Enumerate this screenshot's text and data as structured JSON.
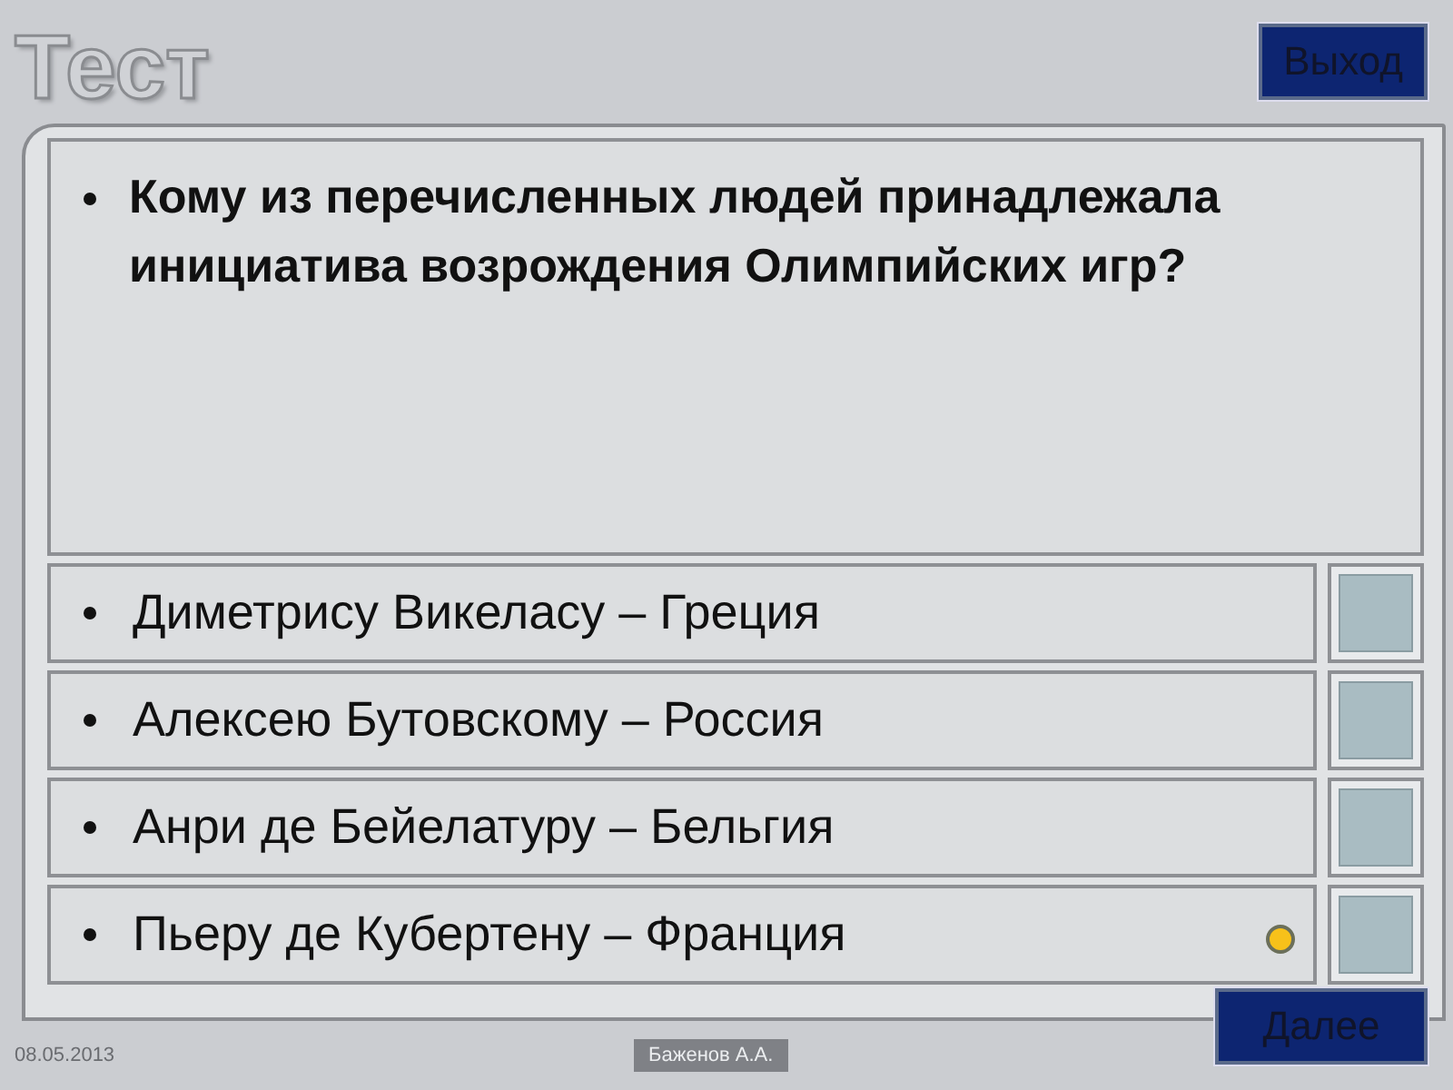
{
  "title": "Тест",
  "exit_button": "Выход",
  "question": "Кому из перечисленных людей принадлежала инициатива возрождения Олимпийских игр?",
  "answers": [
    {
      "text": "Диметрису Викеласу – Греция",
      "marked": false,
      "checked": false
    },
    {
      "text": "Алексею Бутовскому – Россия",
      "marked": false,
      "checked": false
    },
    {
      "text": "Анри де Бейелатуру – Бельгия",
      "marked": false,
      "checked": false
    },
    {
      "text": "Пьеру де Кубертену – Франция",
      "marked": true,
      "checked": false
    }
  ],
  "next_button": "Далее",
  "footer": {
    "date": "08.05.2013",
    "author": "Баженов А.А."
  }
}
